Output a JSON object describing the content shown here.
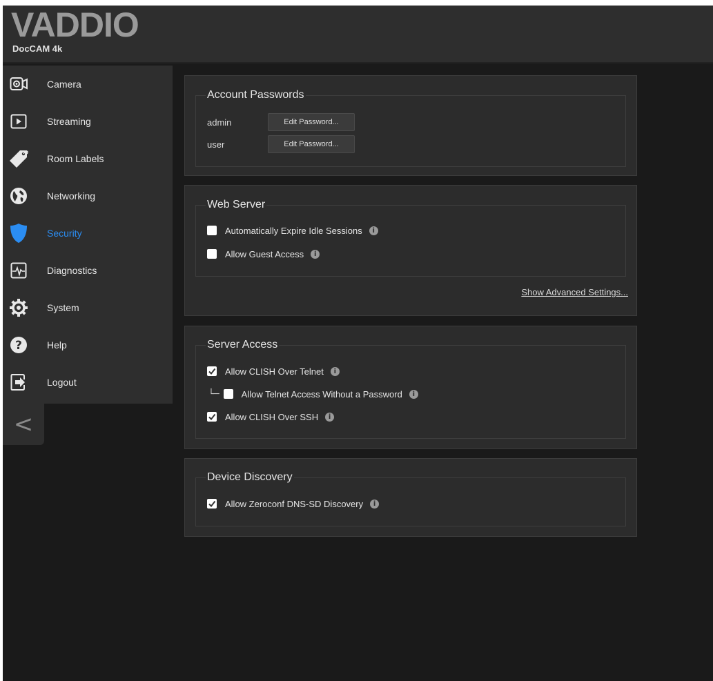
{
  "brand": {
    "logo": "VADDIO",
    "model": "DocCAM 4k"
  },
  "sidebar": {
    "items": [
      {
        "label": "Camera",
        "icon": "camera-icon",
        "active": false
      },
      {
        "label": "Streaming",
        "icon": "play-icon",
        "active": false
      },
      {
        "label": "Room Labels",
        "icon": "tag-icon",
        "active": false
      },
      {
        "label": "Networking",
        "icon": "globe-icon",
        "active": false
      },
      {
        "label": "Security",
        "icon": "shield-icon",
        "active": true
      },
      {
        "label": "Diagnostics",
        "icon": "pulse-icon",
        "active": false
      },
      {
        "label": "System",
        "icon": "gear-icon",
        "active": false
      },
      {
        "label": "Help",
        "icon": "help-icon",
        "active": false
      },
      {
        "label": "Logout",
        "icon": "logout-icon",
        "active": false
      }
    ],
    "collapse_label": "<"
  },
  "account_passwords": {
    "legend": "Account Passwords",
    "rows": [
      {
        "user": "admin",
        "button": "Edit Password..."
      },
      {
        "user": "user",
        "button": "Edit Password..."
      }
    ]
  },
  "web_server": {
    "legend": "Web Server",
    "options": [
      {
        "label": "Automatically Expire Idle Sessions",
        "checked": false
      },
      {
        "label": "Allow Guest Access",
        "checked": false
      }
    ],
    "advanced_link": "Show Advanced Settings..."
  },
  "server_access": {
    "legend": "Server Access",
    "options": [
      {
        "label": "Allow CLISH Over Telnet",
        "checked": true,
        "indent": false
      },
      {
        "label": "Allow Telnet Access Without a Password",
        "checked": false,
        "indent": true
      },
      {
        "label": "Allow CLISH Over SSH",
        "checked": true,
        "indent": false
      }
    ]
  },
  "device_discovery": {
    "legend": "Device Discovery",
    "options": [
      {
        "label": "Allow Zeroconf DNS-SD Discovery",
        "checked": true
      }
    ]
  },
  "colors": {
    "background": "#1a1a1a",
    "panel": "#2c2c2c",
    "sidebar": "#2e2e2e",
    "active_accent": "#2b8df2"
  }
}
